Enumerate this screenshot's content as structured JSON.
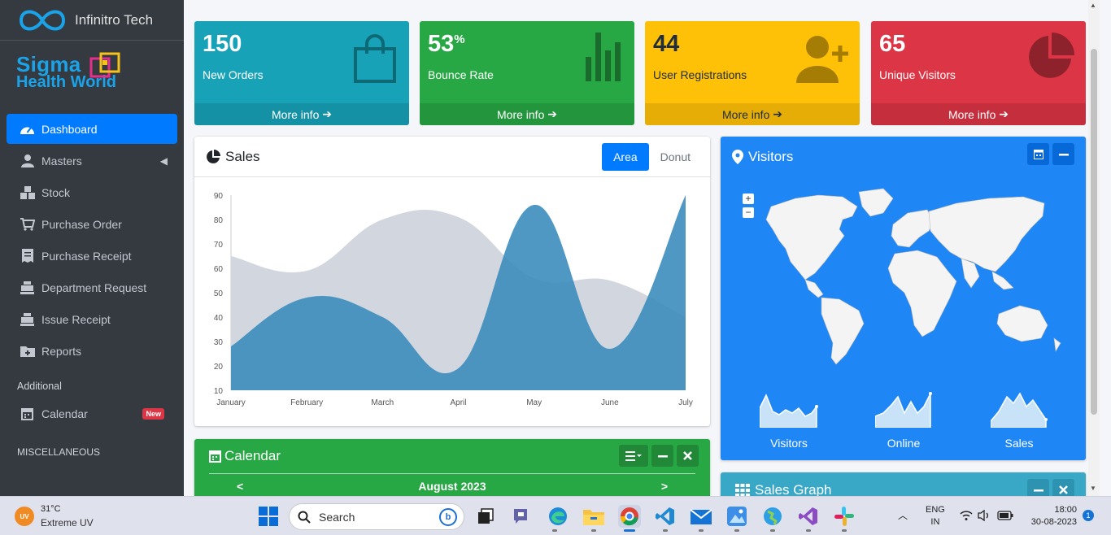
{
  "brand": {
    "name": "Infinitro Tech"
  },
  "logo": {
    "line1": "Sigma",
    "line2": "Health World"
  },
  "sidebar": {
    "items": [
      {
        "label": "Dashboard",
        "icon": "dashboard-icon"
      },
      {
        "label": "Masters",
        "icon": "user-tie-icon"
      },
      {
        "label": "Stock",
        "icon": "cubes-icon"
      },
      {
        "label": "Purchase Order",
        "icon": "cart-plus-icon"
      },
      {
        "label": "Purchase Receipt",
        "icon": "receipt-icon"
      },
      {
        "label": "Department Request",
        "icon": "cash-register-icon"
      },
      {
        "label": "Issue Receipt",
        "icon": "cash-register-icon"
      },
      {
        "label": "Reports",
        "icon": "folder-plus-icon"
      }
    ],
    "additional_header": "Additional",
    "calendar_label": "Calendar",
    "calendar_badge": "New",
    "misc_header": "MISCELLANEOUS"
  },
  "boxes": [
    {
      "value": "150",
      "label": "New Orders",
      "more": "More info",
      "color": "#17a2b8"
    },
    {
      "value": "53",
      "suffix": "%",
      "label": "Bounce Rate",
      "more": "More info",
      "color": "#28a745"
    },
    {
      "value": "44",
      "label": "User Registrations",
      "more": "More info",
      "color": "#ffc107"
    },
    {
      "value": "65",
      "label": "Unique Visitors",
      "more": "More info",
      "color": "#dc3545"
    }
  ],
  "sales": {
    "title": "Sales",
    "tabs": [
      "Area",
      "Donut"
    ]
  },
  "chart_data": {
    "type": "area",
    "categories": [
      "January",
      "February",
      "March",
      "April",
      "May",
      "June",
      "July"
    ],
    "ylim": [
      10,
      90
    ],
    "yticks": [
      10,
      20,
      30,
      40,
      50,
      60,
      70,
      80,
      90
    ],
    "series": [
      {
        "values": [
          65,
          59,
          80,
          81,
          56,
          55,
          40
        ],
        "color": "#d2d6de"
      },
      {
        "values": [
          28,
          48,
          40,
          19,
          86,
          27,
          90
        ],
        "color": "#3c8dbc"
      }
    ]
  },
  "visitors": {
    "title": "Visitors",
    "zoom_in": "+",
    "zoom_out": "−",
    "sparks": [
      {
        "label": "Visitors"
      },
      {
        "label": "Online"
      },
      {
        "label": "Sales"
      }
    ]
  },
  "calendar": {
    "title": "Calendar",
    "month": "August 2023"
  },
  "sales_graph": {
    "title": "Sales Graph"
  },
  "taskbar": {
    "temp": "31°C",
    "weather": "Extreme UV",
    "uv_badge": "UV",
    "search": "Search",
    "lang1": "ENG",
    "lang2": "IN",
    "time": "18:00",
    "date": "30-08-2023",
    "notif": "1"
  }
}
